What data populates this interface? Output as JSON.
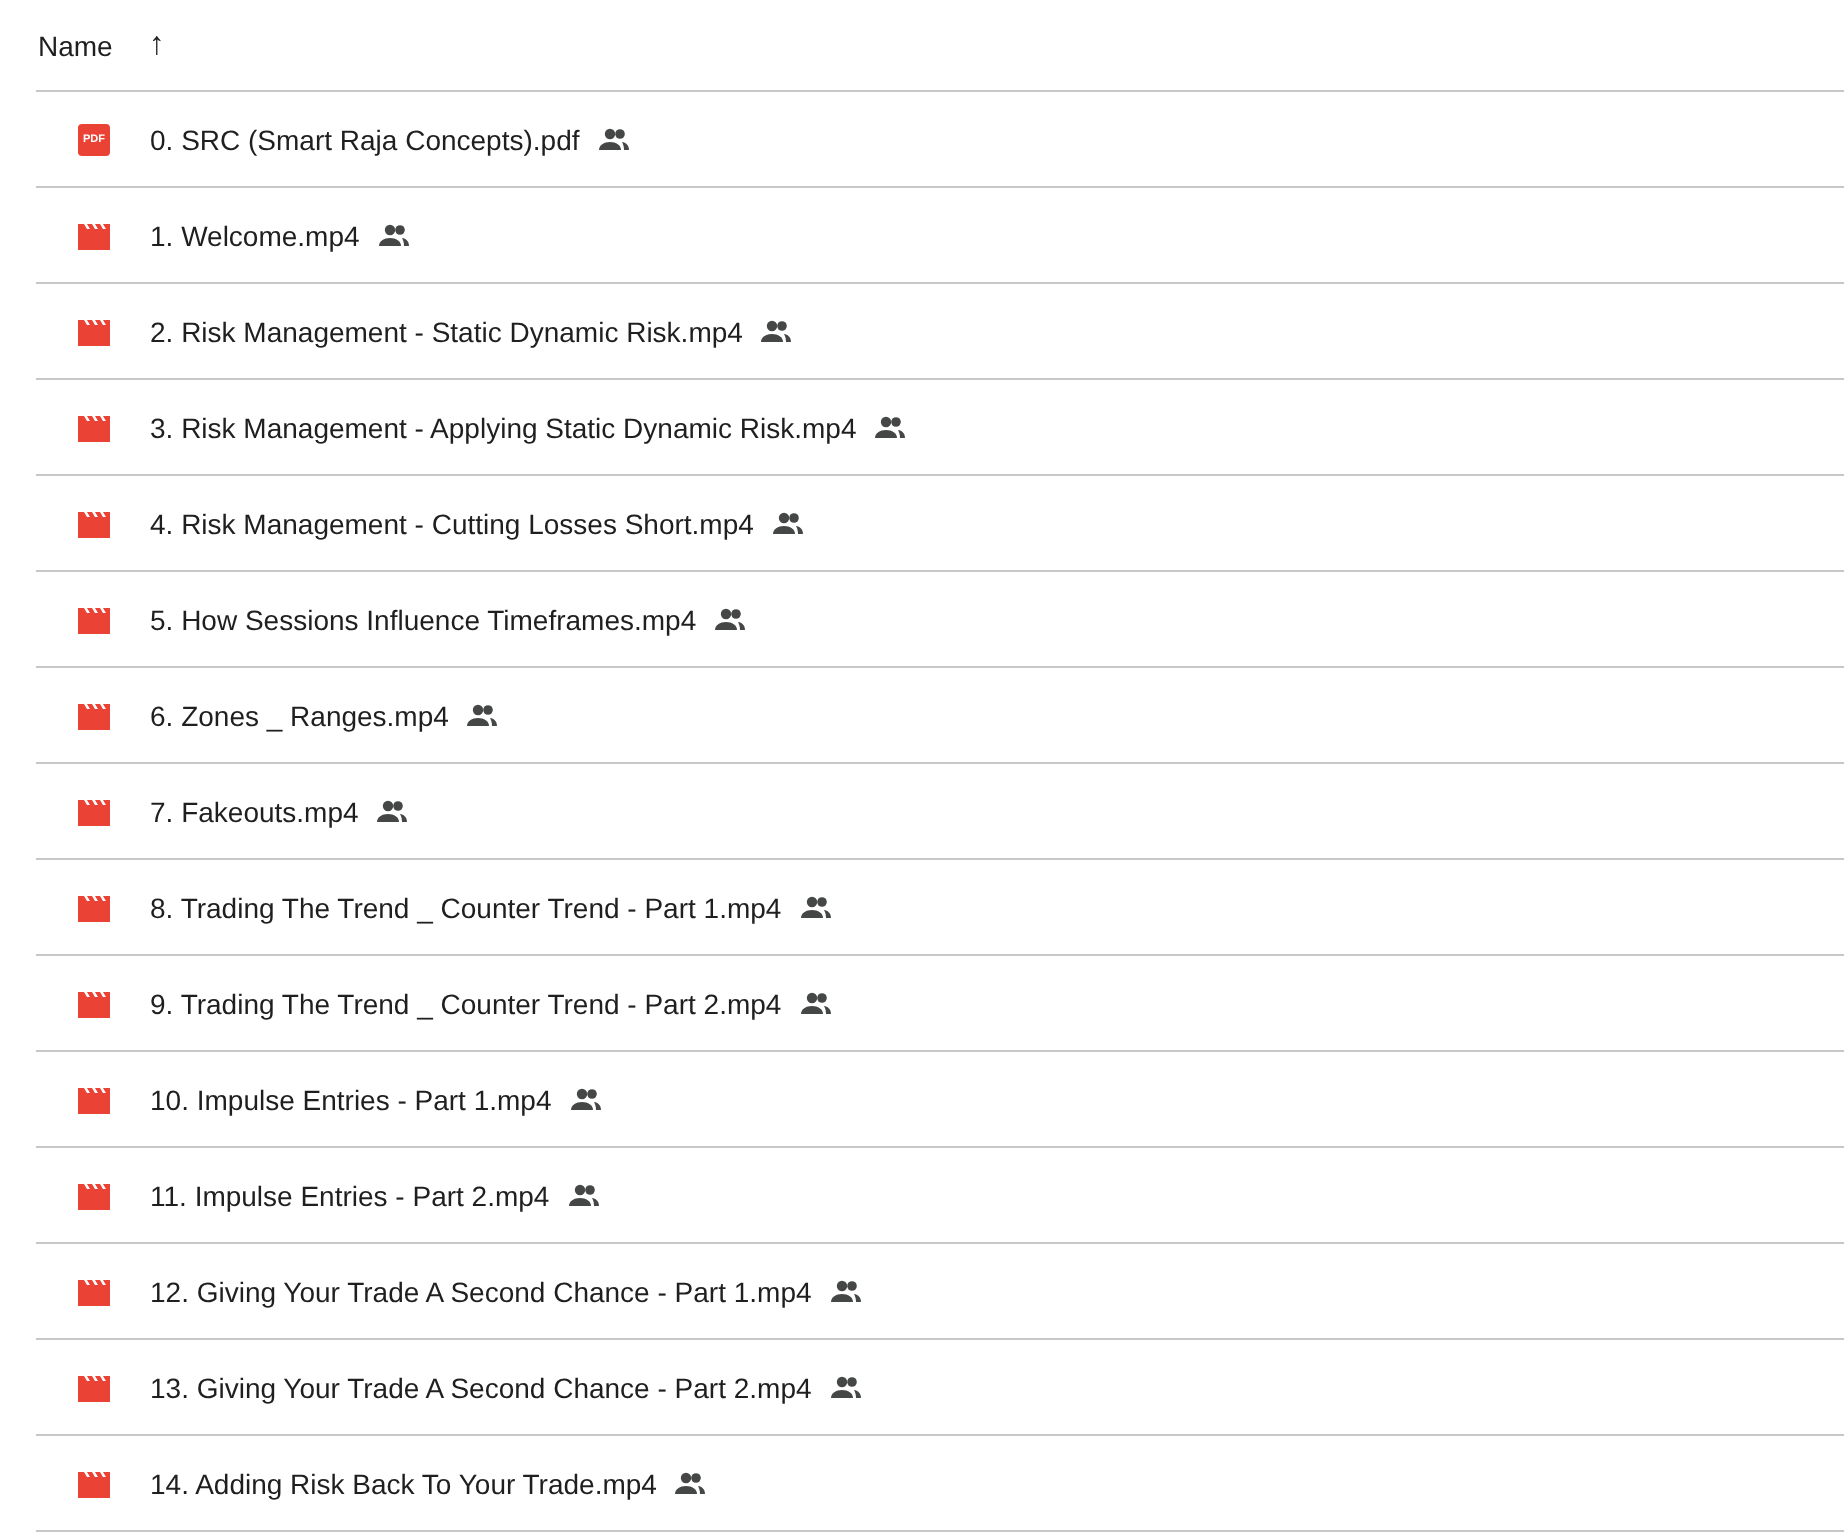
{
  "header": {
    "label": "Name",
    "sort_arrow": "↑"
  },
  "files": [
    {
      "kind": "pdf",
      "badge": "PDF",
      "name": "0. SRC (Smart Raja Concepts).pdf",
      "shared": true
    },
    {
      "kind": "video",
      "name": "1. Welcome.mp4",
      "shared": true
    },
    {
      "kind": "video",
      "name": "2. Risk Management - Static Dynamic Risk.mp4",
      "shared": true
    },
    {
      "kind": "video",
      "name": "3. Risk Management - Applying Static Dynamic Risk.mp4",
      "shared": true
    },
    {
      "kind": "video",
      "name": "4. Risk Management - Cutting Losses Short.mp4",
      "shared": true
    },
    {
      "kind": "video",
      "name": "5. How Sessions Influence Timeframes.mp4",
      "shared": true
    },
    {
      "kind": "video",
      "name": "6. Zones _ Ranges.mp4",
      "shared": true
    },
    {
      "kind": "video",
      "name": "7. Fakeouts.mp4",
      "shared": true
    },
    {
      "kind": "video",
      "name": "8. Trading The Trend _ Counter Trend - Part 1.mp4",
      "shared": true
    },
    {
      "kind": "video",
      "name": "9. Trading The Trend _ Counter Trend - Part 2.mp4",
      "shared": true
    },
    {
      "kind": "video",
      "name": "10. Impulse Entries - Part 1.mp4",
      "shared": true
    },
    {
      "kind": "video",
      "name": "11. Impulse Entries - Part 2.mp4",
      "shared": true
    },
    {
      "kind": "video",
      "name": "12. Giving Your Trade A Second Chance - Part 1.mp4",
      "shared": true
    },
    {
      "kind": "video",
      "name": "13. Giving Your Trade A Second Chance - Part 2.mp4",
      "shared": true
    },
    {
      "kind": "video",
      "name": "14. Adding Risk Back To Your Trade.mp4",
      "shared": true
    }
  ]
}
